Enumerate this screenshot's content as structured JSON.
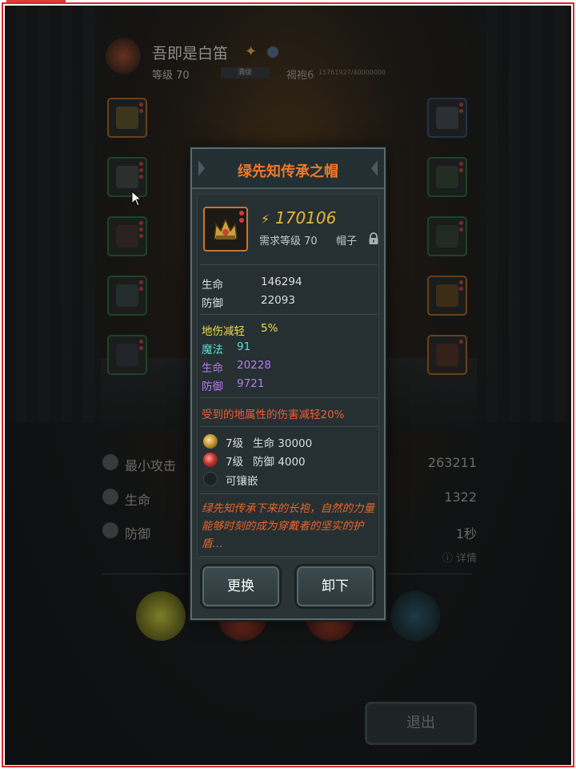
{
  "player": {
    "name": "吾即是白笛",
    "level": "等级 70",
    "level_bar": "满级",
    "rank": "褐袍6",
    "rank_exp": "15761927/40000000"
  },
  "background_stats": {
    "rows": [
      {
        "label": "最小攻击",
        "value": "263211"
      },
      {
        "label": "生命",
        "value": "1322"
      },
      {
        "label": "防御",
        "value": "1秒"
      }
    ],
    "detail": "详情"
  },
  "exit_label": "退出",
  "popup": {
    "title": "绿先知传承之帽",
    "power": "170106",
    "required_level": "需求等级 70",
    "item_type": "帽子",
    "base_attrs": [
      {
        "label": "生命",
        "value": "146294"
      },
      {
        "label": "防御",
        "value": "22093"
      }
    ],
    "bonus_attrs": [
      {
        "label": "地伤减轻",
        "value": "5%"
      },
      {
        "label": "魔法",
        "value": "91"
      },
      {
        "label": "生命",
        "value": "20228"
      },
      {
        "label": "防御",
        "value": "9721"
      }
    ],
    "special_effect": "受到的地属性的伤害减轻20%",
    "sockets": [
      {
        "level": "7级",
        "attr": "生命 30000"
      },
      {
        "level": "7级",
        "attr": "防御 4000"
      },
      {
        "text": "可镶嵌"
      }
    ],
    "flavor_text": "绿先知传承下来的长袍，自然的力量能够时刻的成为穿戴者的坚实的护盾…",
    "buttons": {
      "replace": "更换",
      "unequip": "卸下"
    }
  },
  "colors": {
    "title": "#f07828",
    "power": "#e8b632",
    "bonus_yellow": "#f0dc4a",
    "bonus_cyan": "#5fd9d3",
    "bonus_purple": "#b47af0",
    "effect_red": "#f05a38",
    "frame": "#d8262a"
  },
  "icons": [
    "power-icon",
    "lock-icon",
    "crown-helmet-icon",
    "socket-gem-icon",
    "cursor-icon"
  ]
}
